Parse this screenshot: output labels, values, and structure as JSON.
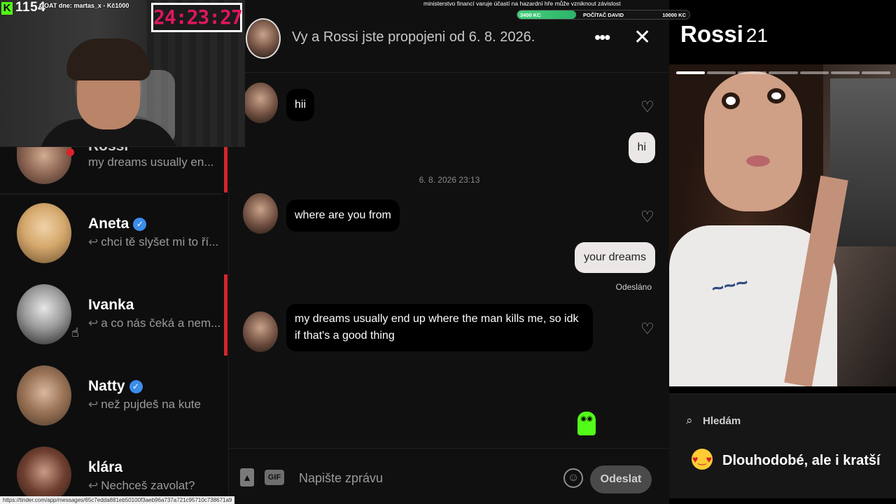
{
  "stream": {
    "viewers": "1154",
    "goat_text": "GOAT dne: martas_x - Kč1000",
    "timer": "24:23:27",
    "disclaimer": "ministerstvo financí varuje účastí na hazardní hře může vzniknout závislost",
    "goal": {
      "left": "3400 KC",
      "middle": "POČÍTAČ DAVID",
      "right": "10000 KC",
      "progress_fraction": 0.34
    },
    "kick_logo": "K"
  },
  "sidebar": {
    "conversations": [
      {
        "name": "Rossi",
        "preview": "my dreams usually en...",
        "reply_icon": false,
        "verified": false,
        "unread": true
      },
      {
        "name": "Aneta",
        "preview": "chci tě slyšet mi to ří...",
        "reply_icon": true,
        "verified": true
      },
      {
        "name": "Ivanka",
        "preview": "a co nás čeká a nem...",
        "reply_icon": true,
        "verified": false
      },
      {
        "name": "Natty",
        "preview": "než pujdeš na kute",
        "reply_icon": true,
        "verified": true
      },
      {
        "name": "klára",
        "preview": "Nechceš zavolat?",
        "reply_icon": true,
        "verified": false
      }
    ],
    "reply_glyph": "↩",
    "verified_glyph": "✓"
  },
  "chat": {
    "header_text": "Vy a Rossi jste propojeni od 6. 8. 2026.",
    "more_icon": "•••",
    "close_icon": "✕",
    "messages": [
      {
        "from": "them",
        "text": "hii"
      },
      {
        "from": "me",
        "text": "hi"
      },
      {
        "from": "them",
        "text": "where are you from"
      },
      {
        "from": "me",
        "text": "your dreams"
      },
      {
        "from": "them",
        "text": "my dreams usually end up where the man kills me, so idk if that's a good thing"
      }
    ],
    "timestamp": "6. 8. 2026 23:13",
    "sent_label": "Odesláno",
    "heart_icon": "♡",
    "composer": {
      "gif_label": "GIF",
      "placeholder": "Napište zprávu",
      "send_label": "Odeslat",
      "emoji_icon": "☺",
      "photo_icon": "👤"
    }
  },
  "profile": {
    "name": "Rossi",
    "age": "21",
    "photo_count": 7,
    "active_photo": 1,
    "looking_for_label": "Hledám",
    "looking_for_value": "Dlouhodobé, ale i kratší",
    "search_icon": "⌕",
    "emoji": "😍"
  },
  "status_url": "https://tinder.com/app/messages/65c7edda881eb50100f3aeb96a737a721c95710c738671a9",
  "colors": {
    "accent_red": "#d4262e",
    "verified_blue": "#3b8eea",
    "kick_green": "#53fc18",
    "timer_pink": "#e0155f"
  }
}
